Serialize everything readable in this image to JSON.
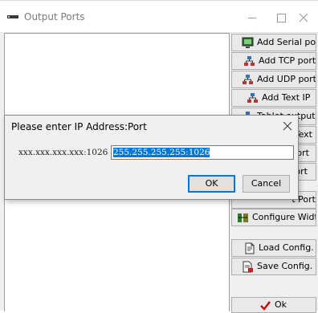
{
  "window": {
    "title": "Output Ports",
    "controls": {
      "minimize": "—",
      "maximize": "☐",
      "close": "✕"
    }
  },
  "sidebar": {
    "buttons": [
      {
        "label": "Add Serial port",
        "icon": "serial-port-icon"
      },
      {
        "label": "Add TCP port",
        "icon": "tcp-network-icon"
      },
      {
        "label": "Add UDP port",
        "icon": "udp-network-icon"
      },
      {
        "label": "Add Text IP",
        "icon": "text-ip-network-icon"
      },
      {
        "label": "Tablet output",
        "icon": "tablet-network-icon",
        "partially_hidden": true
      },
      {
        "label": "Text",
        "icon": "",
        "partially_hidden": true
      },
      {
        "label": "port",
        "icon": "",
        "partially_hidden": true
      },
      {
        "label": "ort",
        "icon": "",
        "partially_hidden": true
      },
      {
        "label": "t Port",
        "icon": "",
        "partially_hidden": true
      },
      {
        "label": "Configure Widths",
        "icon": "configure-widths-icon"
      },
      {
        "label": "Load Config.",
        "icon": "load-document-icon"
      },
      {
        "label": "Save Config.",
        "icon": "save-document-icon"
      },
      {
        "label": "Ok",
        "icon": "check-icon"
      }
    ]
  },
  "dialog": {
    "title": "Please enter IP Address:Port",
    "prompt": "xxx.xxx.xxx.xxx:1026",
    "input_value": "255.255.255.255:1026",
    "ok_label": "OK",
    "cancel_label": "Cancel",
    "close_glyph": "✕"
  },
  "colors": {
    "selection": "#0078d7",
    "face": "#f0f0f0",
    "button": "#e1e1e1",
    "check_red": "#cc0000"
  }
}
